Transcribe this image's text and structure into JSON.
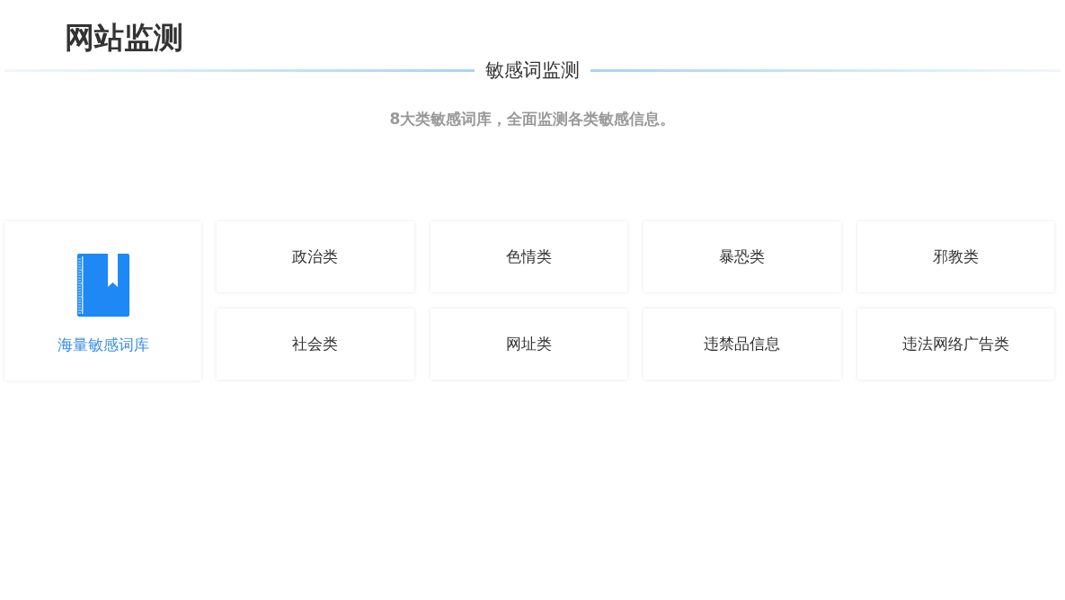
{
  "page_title": "网站监测",
  "section": {
    "title": "敏感词监测",
    "subtitle": "8大类敏感词库，全面监测各类敏感信息。"
  },
  "feature": {
    "label": "海量敏感词库"
  },
  "categories": [
    "政治类",
    "色情类",
    "暴恐类",
    "邪教类",
    "社会类",
    "网址类",
    "违禁品信息",
    "违法网络广告类"
  ]
}
